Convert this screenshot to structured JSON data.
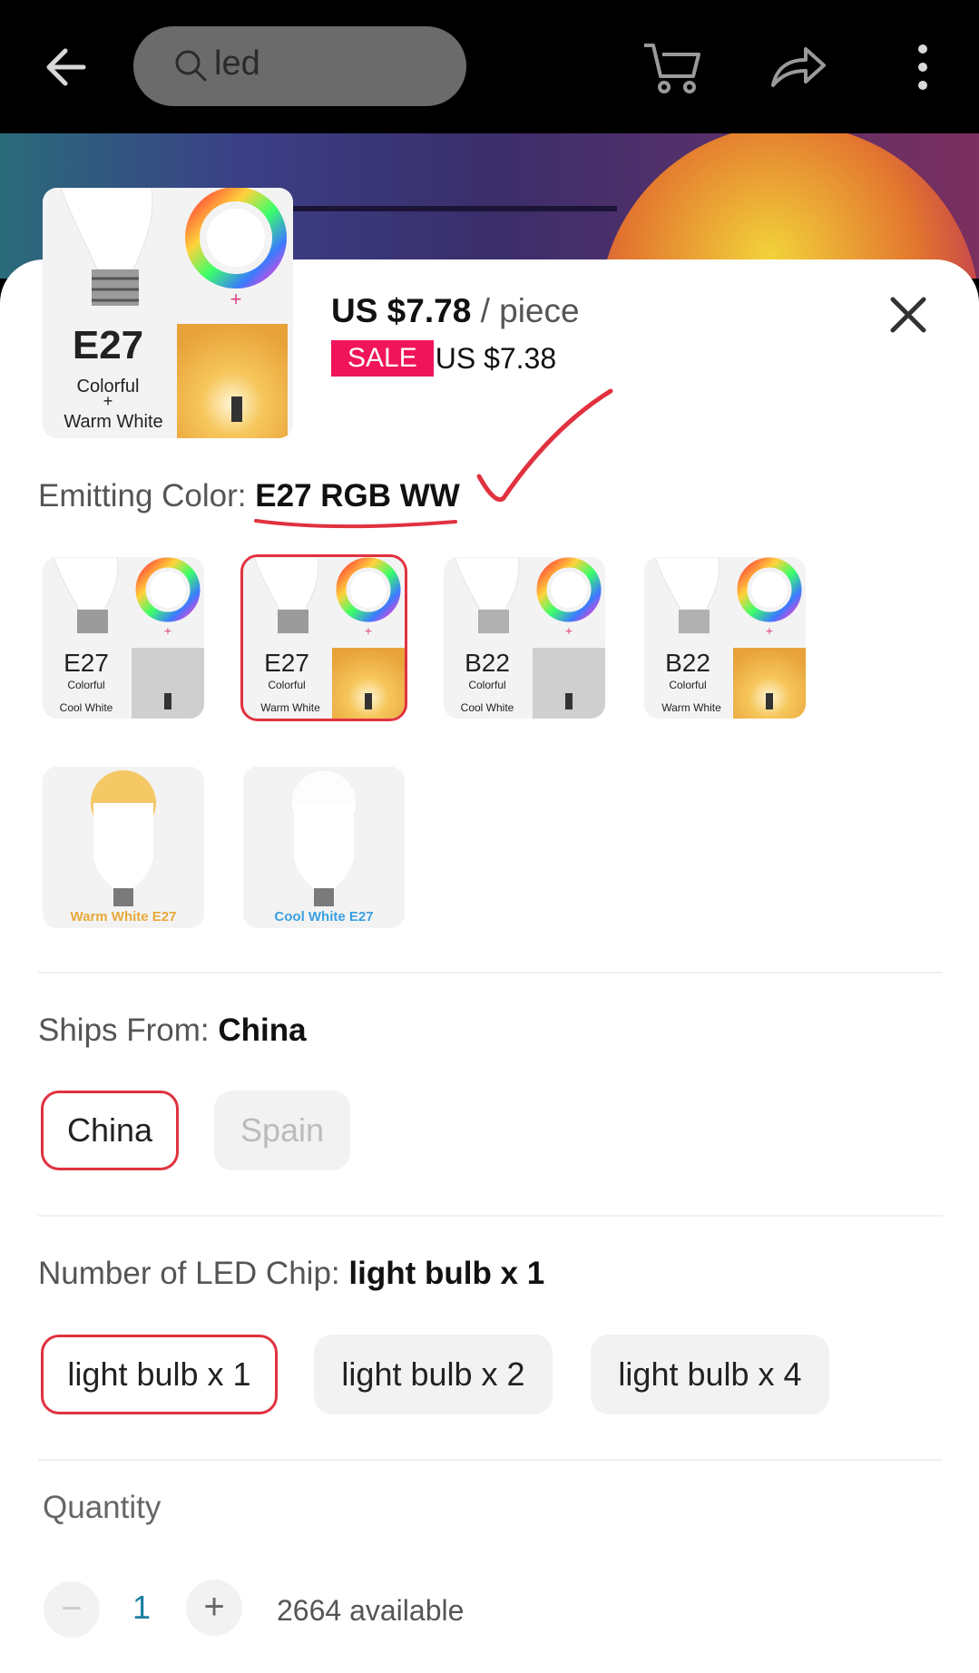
{
  "search": {
    "query": "led"
  },
  "product": {
    "price": "US $7.78",
    "unit": "/ piece",
    "sale_badge": "SALE",
    "sale_price": "US $7.38"
  },
  "emitting_color": {
    "label": "Emitting Color:",
    "selected": "E27 RGB WW",
    "options": [
      {
        "line1": "E27",
        "line2": "Colorful",
        "line3": "Cool White",
        "selected": false
      },
      {
        "line1": "E27",
        "line2": "Colorful",
        "line3": "Warm White",
        "selected": true
      },
      {
        "line1": "B22",
        "line2": "Colorful",
        "line3": "Cool White",
        "selected": false
      },
      {
        "line1": "B22",
        "line2": "Colorful",
        "line3": "Warm White",
        "selected": false
      },
      {
        "line1": "Warm White  E27",
        "selected": false
      },
      {
        "line1": "Cool White  E27",
        "selected": false
      }
    ]
  },
  "main_thumb": {
    "line1": "E27",
    "line2": "Colorful",
    "plus": "+",
    "line3": "Warm White"
  },
  "ships_from": {
    "label": "Ships From:",
    "selected": "China",
    "options": [
      "China",
      "Spain"
    ]
  },
  "led_chip": {
    "label": "Number of LED Chip:",
    "selected": "light bulb x 1",
    "options": [
      "light bulb x 1",
      "light bulb x 2",
      "light bulb x 4"
    ]
  },
  "quantity": {
    "label": "Quantity",
    "value": "1",
    "minus": "−",
    "plus": "+",
    "available": "2664 available"
  },
  "colors": {
    "accent": "#e0323f",
    "sale": "#f0145a",
    "qty": "#1a7fa0"
  }
}
